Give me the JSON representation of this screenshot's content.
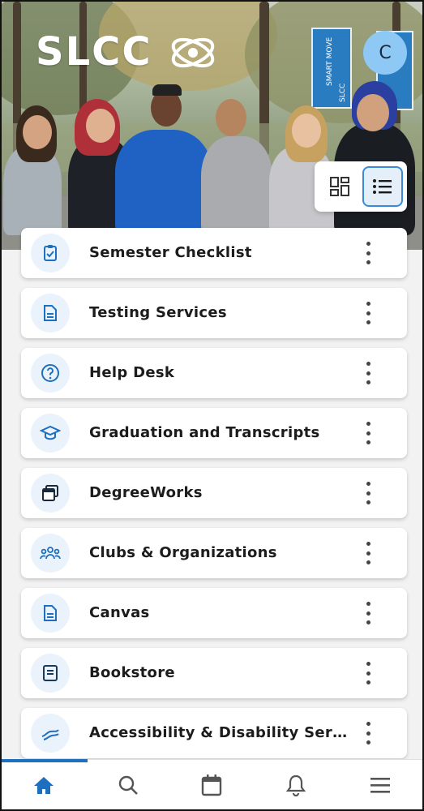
{
  "header": {
    "logo_text": "SLCC",
    "avatar_initial": "C"
  },
  "hero": {
    "banner_1": "SMART MOVE",
    "banner_1_sub": "SLCC"
  },
  "view_toggle": {
    "options": [
      "grid",
      "list"
    ],
    "selected": "list"
  },
  "cards": [
    {
      "label": "Semester Checklist",
      "icon": "clipboard-check-icon"
    },
    {
      "label": "Testing Services",
      "icon": "document-icon"
    },
    {
      "label": "Help Desk",
      "icon": "help-circle-icon"
    },
    {
      "label": "Graduation and Transcripts",
      "icon": "graduation-cap-icon"
    },
    {
      "label": "DegreeWorks",
      "icon": "window-stack-icon"
    },
    {
      "label": "Clubs & Organizations",
      "icon": "people-group-icon"
    },
    {
      "label": "Canvas",
      "icon": "document-icon"
    },
    {
      "label": "Bookstore",
      "icon": "book-icon"
    },
    {
      "label": "Accessibility & Disability Servi...",
      "icon": "accessibility-hands-icon"
    }
  ],
  "bottom_nav": {
    "items": [
      "home",
      "search",
      "calendar",
      "notifications",
      "menu"
    ],
    "active": "home"
  },
  "colors": {
    "accent": "#1f6fbf",
    "icon_bg": "#eaf2fb",
    "avatar_bg": "#8ec8f5"
  }
}
